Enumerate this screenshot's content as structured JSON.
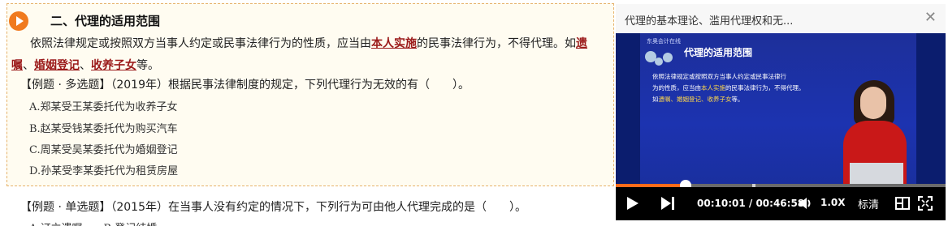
{
  "lesson": {
    "section_title": "二、代理的适用范围",
    "para_text_1": "依照法律规定或按照双方当事人约定或民事法律行为的性质，应当由",
    "para_kw_1": "本人实施",
    "para_text_2": "的民事法律行为，不得代理。如",
    "para_kw_2": "遗嘱",
    "para_sep_1": "、",
    "para_kw_3": "婚姻登记",
    "para_sep_2": "、",
    "para_kw_4": "收养子女",
    "para_text_3": "等。",
    "q1": "【例题 · 多选题】（2019年）根据民事法律制度的规定，下列代理行为无效的有（　　）。",
    "q1_options": [
      "A.郑某受王某委托代为收养子女",
      "B.赵某受钱某委托代为购买汽车",
      "C.周某受吴某委托代为婚姻登记",
      "D.孙某受李某委托代为租赁房屋"
    ],
    "q2": "【例题 · 单选题】（2015年）在当事人没有约定的情况下，下列行为可由他人代理完成的是（　　）。",
    "q2_partial": "A.订立遗嘱　　B.登记结婚"
  },
  "player": {
    "title": "代理的基本理论、滥用代理权和无...",
    "slide_title": "代理的适用范围",
    "slide_logo": "东奥会计在线",
    "slide_line_1": "依照法律规定或按照双方当事人约定或民事法律行",
    "slide_line_2a": "为的性质，应当由",
    "slide_line_2_hl": "本人实施",
    "slide_line_2b": "的民事法律行为，不得代理。",
    "slide_line_3a": "如",
    "slide_line_3_hl": "遗嘱、婚姻登记、收养子女",
    "slide_line_3b": "等。",
    "current_time": "00:10:01",
    "separator": " / ",
    "total_time": "00:46:58",
    "speed": "1.0X",
    "quality": "标清",
    "progress": 0.213,
    "colors": {
      "accent": "#ff6b1a",
      "keyword": "#9b1a1a"
    }
  }
}
